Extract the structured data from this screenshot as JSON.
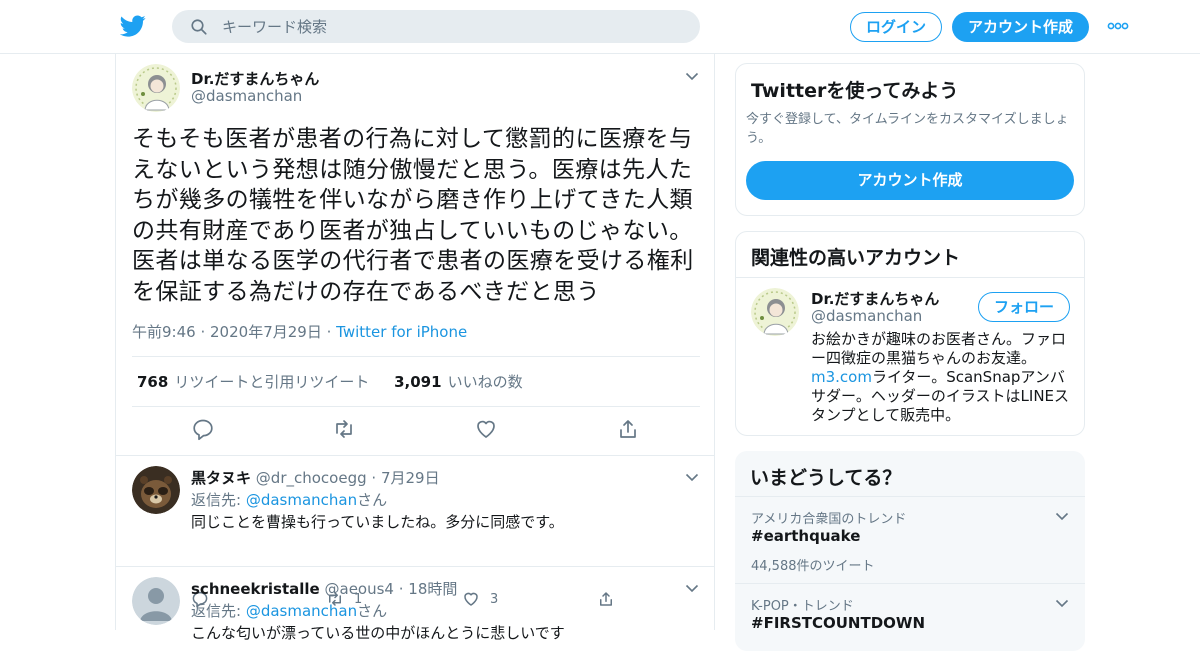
{
  "header": {
    "logo_icon": "twitter-bird-icon",
    "search_placeholder": "キーワード検索",
    "login_label": "ログイン",
    "signup_label": "アカウント作成",
    "more_icon": "more-dots-icon",
    "brand_color": "#1da1f2"
  },
  "tweet": {
    "display_name": "Dr.だすまんちゃん",
    "handle": "@dasmanchan",
    "text": "そもそも医者が患者の行為に対して懲罰的に医療を与えないという発想は随分傲慢だと思う。医療は先人たちが幾多の犠牲を伴いながら磨き作り上げてきた人類の共有財産であり医者が独占していいものじゃない。医者は単なる医学の代行者で患者の医療を受ける権利を保証する為だけの存在であるべきだと思う",
    "time": "午前9:46",
    "date": "2020年7月29日",
    "source": "Twitter for iPhone",
    "retweet_count": "768",
    "retweet_label": "リツイートと引用リツイート",
    "like_count": "3,091",
    "like_label": "いいねの数"
  },
  "replies": [
    {
      "display_name": "黒タヌキ",
      "handle": "@dr_chocoegg",
      "time": "7月29日",
      "reply_prefix": "返信先: ",
      "reply_to": "@dasmanchan",
      "reply_suffix": "さん",
      "text": "同じことを曹操も行っていましたね。多分に同感です。",
      "retweets": "1",
      "likes": "3"
    },
    {
      "display_name": "schneekristalle",
      "handle": "@aeous4",
      "time": "18時間",
      "reply_prefix": "返信先: ",
      "reply_to": "@dasmanchan",
      "reply_suffix": "さん",
      "text": "こんな匂いが漂っている世の中がほんとうに悲しいです"
    }
  ],
  "sidebar": {
    "try_title": "Twitterを使ってみよう",
    "try_desc": "今すぐ登録して、タイムラインをカスタマイズしましょう。",
    "try_button": "アカウント作成",
    "related_title": "関連性の高いアカウント",
    "related": {
      "display_name": "Dr.だすまんちゃん",
      "handle": "@dasmanchan",
      "follow_label": "フォロー",
      "bio_1": "お絵かきが趣味のお医者さん。ファロー四徴症の黒猫ちゃんのお友達。",
      "bio_link": "m3.com",
      "bio_2": "ライター。ScanSnapアンバサダー。ヘッダーのイラストはLINEスタンプとして販売中。"
    },
    "trends_title": "いまどうしてる？",
    "trends": [
      {
        "context": "アメリカ合衆国のトレンド",
        "name": "#earthquake",
        "count": "44,588件のツイート"
      },
      {
        "context": "K-POP・トレンド",
        "name": "#FIRSTCOUNTDOWN"
      }
    ]
  }
}
